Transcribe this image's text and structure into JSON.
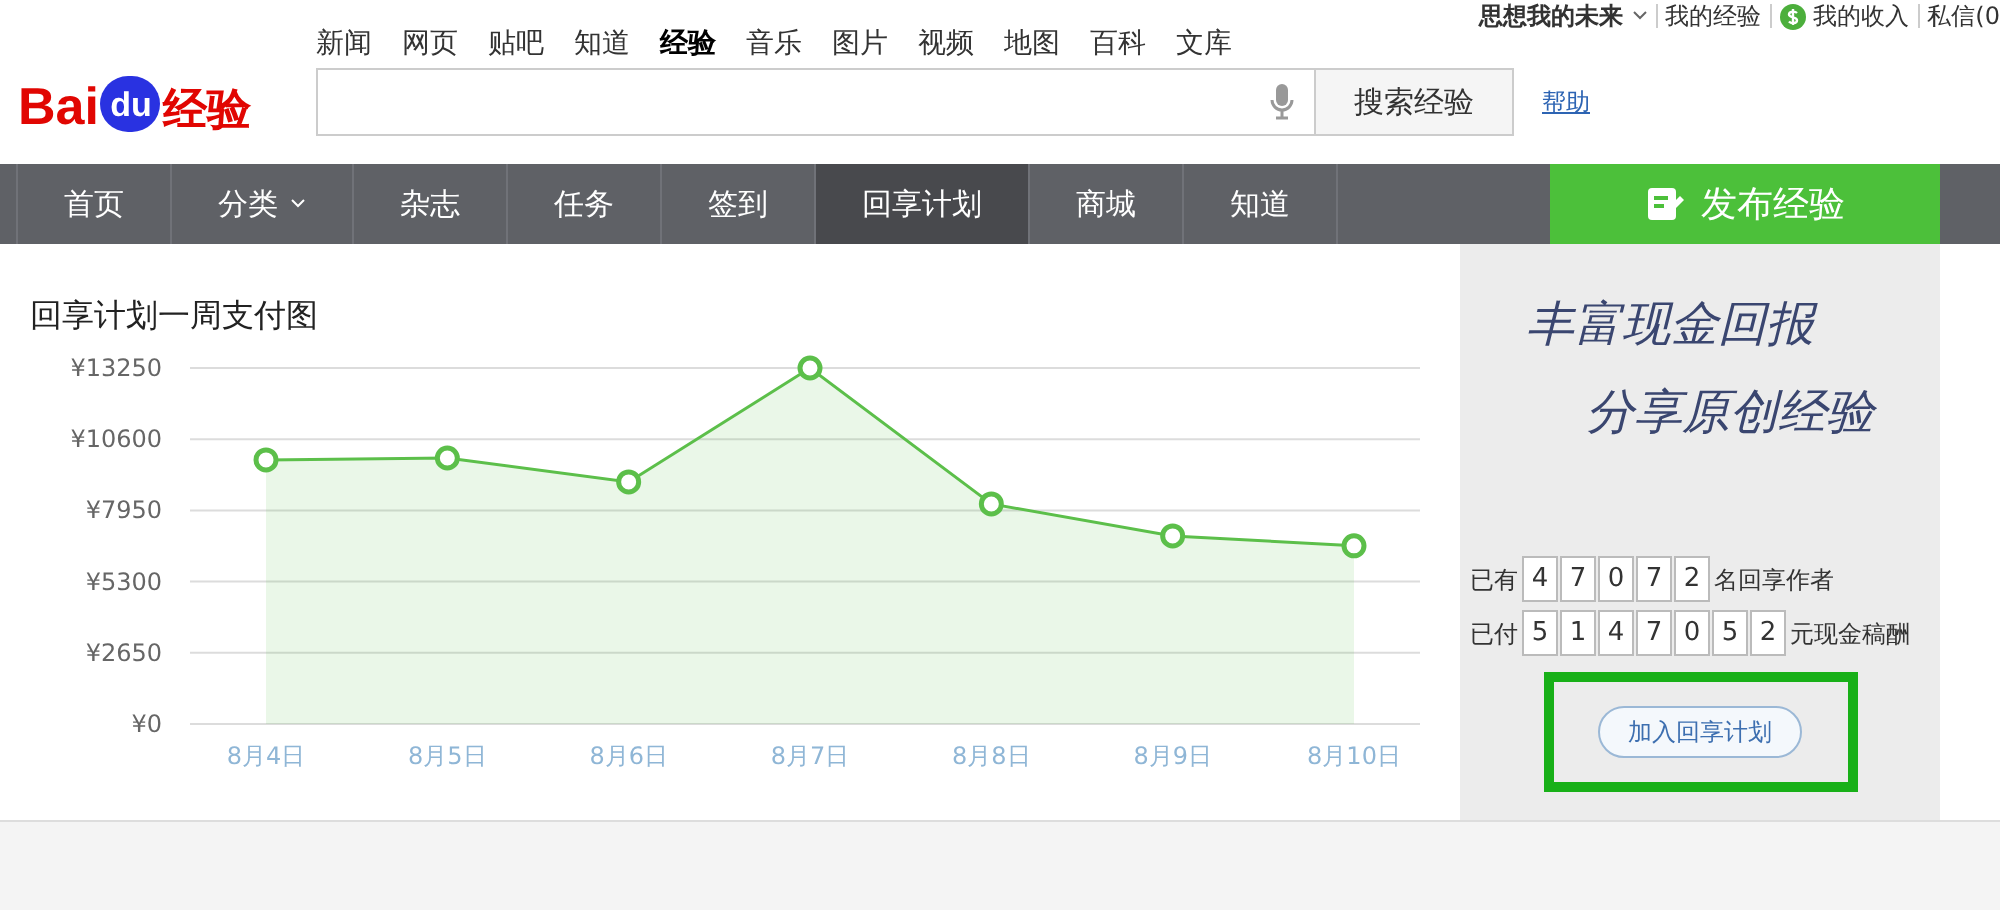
{
  "logo": {
    "text_left": "Bai",
    "text_badge": "du",
    "text_right": "经验"
  },
  "top_nav": [
    {
      "label": "新闻",
      "selected": false
    },
    {
      "label": "网页",
      "selected": false
    },
    {
      "label": "贴吧",
      "selected": false
    },
    {
      "label": "知道",
      "selected": false
    },
    {
      "label": "经验",
      "selected": true
    },
    {
      "label": "音乐",
      "selected": false
    },
    {
      "label": "图片",
      "selected": false
    },
    {
      "label": "视频",
      "selected": false
    },
    {
      "label": "地图",
      "selected": false
    },
    {
      "label": "百科",
      "selected": false
    },
    {
      "label": "文库",
      "selected": false
    }
  ],
  "user_bar": {
    "username": "思想我的未来",
    "links": [
      "我的经验",
      "我的收入",
      "私信(0"
    ]
  },
  "search": {
    "button": "搜索经验",
    "help": "帮助"
  },
  "main_nav": [
    {
      "label": "首页",
      "selected": false,
      "dropdown": false
    },
    {
      "label": "分类",
      "selected": false,
      "dropdown": true
    },
    {
      "label": "杂志",
      "selected": false,
      "dropdown": false
    },
    {
      "label": "任务",
      "selected": false,
      "dropdown": false
    },
    {
      "label": "签到",
      "selected": false,
      "dropdown": false
    },
    {
      "label": "回享计划",
      "selected": true,
      "dropdown": false
    },
    {
      "label": "商城",
      "selected": false,
      "dropdown": false
    },
    {
      "label": "知道",
      "selected": false,
      "dropdown": false
    }
  ],
  "publish_button": "发布经验",
  "chart": {
    "title": "回享计划一周支付图",
    "chart_data": {
      "type": "area",
      "categories": [
        "8月4日",
        "8月5日",
        "8月6日",
        "8月7日",
        "8月8日",
        "8月9日",
        "8月10日"
      ],
      "grid": true,
      "series": [
        {
          "color": "#5cbf4a",
          "values": [
            9830,
            9900,
            9010,
            13250,
            8190,
            7000,
            6630
          ]
        }
      ],
      "ylim": [
        0,
        13250
      ],
      "yticks": [
        {
          "value": 0,
          "label": "¥0"
        },
        {
          "value": 2650,
          "label": "¥2650"
        },
        {
          "value": 5300,
          "label": "¥5300"
        },
        {
          "value": 7950,
          "label": "¥7950"
        },
        {
          "value": 10600,
          "label": "¥10600"
        },
        {
          "value": 13250,
          "label": "¥13250"
        }
      ]
    }
  },
  "promo": {
    "slogan_lines": [
      "丰富现金回报",
      "分享原创经验"
    ],
    "counters": [
      {
        "prefix": "已有",
        "digits": [
          "4",
          "7",
          "0",
          "7",
          "2"
        ],
        "suffix": "名回享作者"
      },
      {
        "prefix": "已付",
        "digits": [
          "5",
          "1",
          "4",
          "7",
          "0",
          "5",
          "2"
        ],
        "suffix": "元现金稿酬"
      }
    ],
    "join_button": "加入回享计划",
    "highlighted": true
  }
}
